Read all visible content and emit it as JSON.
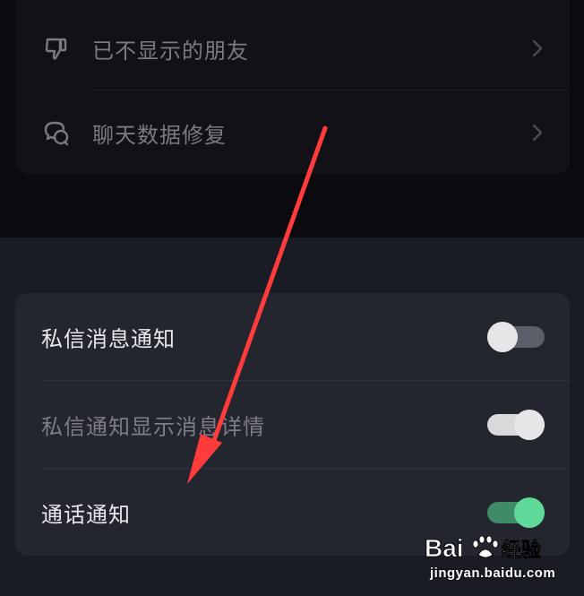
{
  "top_section": {
    "items": [
      {
        "label": "已不显示的朋友",
        "icon": "thumbs-down-icon"
      },
      {
        "label": "聊天数据修复",
        "icon": "chat-bubbles-icon"
      }
    ]
  },
  "notification_section": {
    "items": [
      {
        "label": "私信消息通知",
        "toggle": "off"
      },
      {
        "label": "私信通知显示消息详情",
        "toggle": "on-disabled"
      },
      {
        "label": "通话通知",
        "toggle": "on"
      }
    ]
  },
  "annotation": {
    "type": "red-arrow",
    "color": "#ff3b3b"
  },
  "watermark": {
    "logo_text": "Bai经验",
    "url": "jingyan.baidu.com"
  },
  "colors": {
    "accent_green": "#5fd99a",
    "background_top": "#0b0b0f",
    "background_bottom": "#1a1c25"
  }
}
